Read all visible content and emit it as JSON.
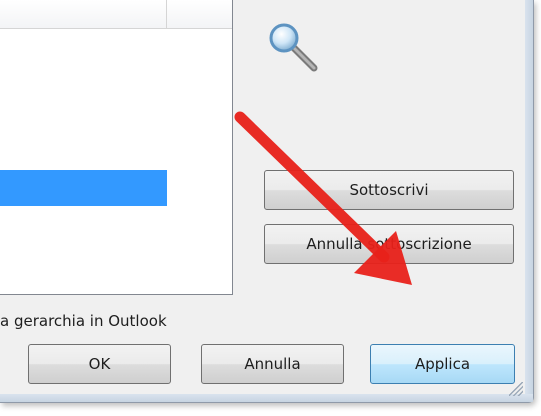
{
  "buttons": {
    "subscribe": "Sottoscrivi",
    "unsubscribe": "Annulla sottoscrizione",
    "ok": "OK",
    "cancel": "Annulla",
    "apply": "Applica"
  },
  "hierarchy_checkbox_label": "a gerarchia in Outlook",
  "icons": {
    "search": "search-icon",
    "arrow": "red-arrow-annotation"
  },
  "colors": {
    "selection": "#3399ff",
    "arrow": "#e8211a",
    "dialog_bg": "#f0f0f0"
  }
}
